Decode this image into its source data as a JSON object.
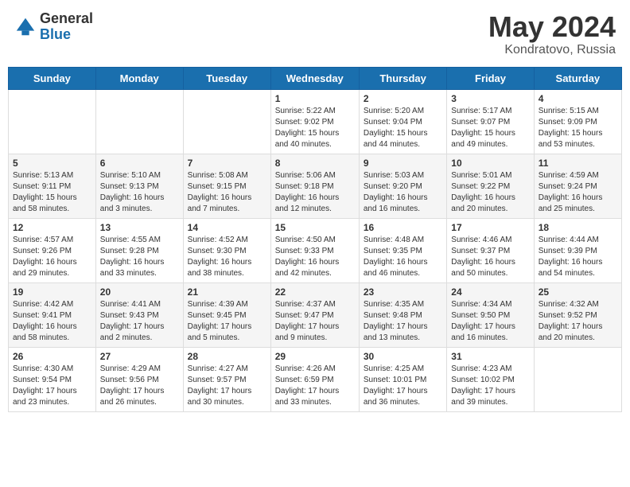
{
  "header": {
    "logo_general": "General",
    "logo_blue": "Blue",
    "month_title": "May 2024",
    "location": "Kondratovo, Russia"
  },
  "days_of_week": [
    "Sunday",
    "Monday",
    "Tuesday",
    "Wednesday",
    "Thursday",
    "Friday",
    "Saturday"
  ],
  "weeks": [
    [
      {
        "day": "",
        "info": ""
      },
      {
        "day": "",
        "info": ""
      },
      {
        "day": "",
        "info": ""
      },
      {
        "day": "1",
        "info": "Sunrise: 5:22 AM\nSunset: 9:02 PM\nDaylight: 15 hours\nand 40 minutes."
      },
      {
        "day": "2",
        "info": "Sunrise: 5:20 AM\nSunset: 9:04 PM\nDaylight: 15 hours\nand 44 minutes."
      },
      {
        "day": "3",
        "info": "Sunrise: 5:17 AM\nSunset: 9:07 PM\nDaylight: 15 hours\nand 49 minutes."
      },
      {
        "day": "4",
        "info": "Sunrise: 5:15 AM\nSunset: 9:09 PM\nDaylight: 15 hours\nand 53 minutes."
      }
    ],
    [
      {
        "day": "5",
        "info": "Sunrise: 5:13 AM\nSunset: 9:11 PM\nDaylight: 15 hours\nand 58 minutes."
      },
      {
        "day": "6",
        "info": "Sunrise: 5:10 AM\nSunset: 9:13 PM\nDaylight: 16 hours\nand 3 minutes."
      },
      {
        "day": "7",
        "info": "Sunrise: 5:08 AM\nSunset: 9:15 PM\nDaylight: 16 hours\nand 7 minutes."
      },
      {
        "day": "8",
        "info": "Sunrise: 5:06 AM\nSunset: 9:18 PM\nDaylight: 16 hours\nand 12 minutes."
      },
      {
        "day": "9",
        "info": "Sunrise: 5:03 AM\nSunset: 9:20 PM\nDaylight: 16 hours\nand 16 minutes."
      },
      {
        "day": "10",
        "info": "Sunrise: 5:01 AM\nSunset: 9:22 PM\nDaylight: 16 hours\nand 20 minutes."
      },
      {
        "day": "11",
        "info": "Sunrise: 4:59 AM\nSunset: 9:24 PM\nDaylight: 16 hours\nand 25 minutes."
      }
    ],
    [
      {
        "day": "12",
        "info": "Sunrise: 4:57 AM\nSunset: 9:26 PM\nDaylight: 16 hours\nand 29 minutes."
      },
      {
        "day": "13",
        "info": "Sunrise: 4:55 AM\nSunset: 9:28 PM\nDaylight: 16 hours\nand 33 minutes."
      },
      {
        "day": "14",
        "info": "Sunrise: 4:52 AM\nSunset: 9:30 PM\nDaylight: 16 hours\nand 38 minutes."
      },
      {
        "day": "15",
        "info": "Sunrise: 4:50 AM\nSunset: 9:33 PM\nDaylight: 16 hours\nand 42 minutes."
      },
      {
        "day": "16",
        "info": "Sunrise: 4:48 AM\nSunset: 9:35 PM\nDaylight: 16 hours\nand 46 minutes."
      },
      {
        "day": "17",
        "info": "Sunrise: 4:46 AM\nSunset: 9:37 PM\nDaylight: 16 hours\nand 50 minutes."
      },
      {
        "day": "18",
        "info": "Sunrise: 4:44 AM\nSunset: 9:39 PM\nDaylight: 16 hours\nand 54 minutes."
      }
    ],
    [
      {
        "day": "19",
        "info": "Sunrise: 4:42 AM\nSunset: 9:41 PM\nDaylight: 16 hours\nand 58 minutes."
      },
      {
        "day": "20",
        "info": "Sunrise: 4:41 AM\nSunset: 9:43 PM\nDaylight: 17 hours\nand 2 minutes."
      },
      {
        "day": "21",
        "info": "Sunrise: 4:39 AM\nSunset: 9:45 PM\nDaylight: 17 hours\nand 5 minutes."
      },
      {
        "day": "22",
        "info": "Sunrise: 4:37 AM\nSunset: 9:47 PM\nDaylight: 17 hours\nand 9 minutes."
      },
      {
        "day": "23",
        "info": "Sunrise: 4:35 AM\nSunset: 9:48 PM\nDaylight: 17 hours\nand 13 minutes."
      },
      {
        "day": "24",
        "info": "Sunrise: 4:34 AM\nSunset: 9:50 PM\nDaylight: 17 hours\nand 16 minutes."
      },
      {
        "day": "25",
        "info": "Sunrise: 4:32 AM\nSunset: 9:52 PM\nDaylight: 17 hours\nand 20 minutes."
      }
    ],
    [
      {
        "day": "26",
        "info": "Sunrise: 4:30 AM\nSunset: 9:54 PM\nDaylight: 17 hours\nand 23 minutes."
      },
      {
        "day": "27",
        "info": "Sunrise: 4:29 AM\nSunset: 9:56 PM\nDaylight: 17 hours\nand 26 minutes."
      },
      {
        "day": "28",
        "info": "Sunrise: 4:27 AM\nSunset: 9:57 PM\nDaylight: 17 hours\nand 30 minutes."
      },
      {
        "day": "29",
        "info": "Sunrise: 4:26 AM\nSunset: 6:59 PM\nDaylight: 17 hours\nand 33 minutes."
      },
      {
        "day": "30",
        "info": "Sunrise: 4:25 AM\nSunset: 10:01 PM\nDaylight: 17 hours\nand 36 minutes."
      },
      {
        "day": "31",
        "info": "Sunrise: 4:23 AM\nSunset: 10:02 PM\nDaylight: 17 hours\nand 39 minutes."
      },
      {
        "day": "",
        "info": ""
      }
    ]
  ]
}
